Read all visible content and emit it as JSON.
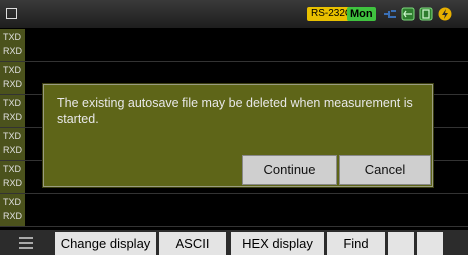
{
  "status": {
    "rs_label": "RS-232C",
    "mon_label": "Mon",
    "colors": {
      "rs": "#e8c000",
      "mon": "#3fc33f"
    },
    "icons": [
      "window-icon",
      "cable-icon",
      "network-icon",
      "storage-icon",
      "power-icon"
    ]
  },
  "rows": [
    {
      "txd": "TXD",
      "rxd": "RXD"
    },
    {
      "txd": "TXD",
      "rxd": "RXD"
    },
    {
      "txd": "TXD",
      "rxd": "RXD"
    },
    {
      "txd": "TXD",
      "rxd": "RXD"
    },
    {
      "txd": "TXD",
      "rxd": "RXD"
    },
    {
      "txd": "TXD",
      "rxd": "RXD"
    }
  ],
  "dialog": {
    "message": "The existing autosave file may be deleted when measurement is started.",
    "continue_label": "Continue",
    "cancel_label": "Cancel"
  },
  "toolbar": {
    "change_display": "Change display",
    "ascii": "ASCII",
    "hex_display": "HEX display",
    "find": "Find"
  }
}
